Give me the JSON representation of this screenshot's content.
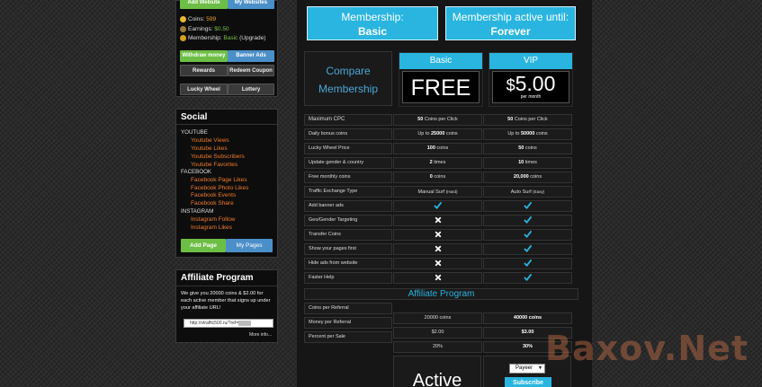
{
  "sidebar": {
    "top_buttons": {
      "add_website": "Add Website",
      "my_websites": "My Websites"
    },
    "coins_label": "Coins: ",
    "coins_value": "599",
    "earnings_label": "Earnings: ",
    "earnings_value": "$0.50",
    "membership_label": "Membership: ",
    "membership_value": "Basic",
    "membership_upgrade": "(Upgrade)",
    "buttons": {
      "withdraw": "Withdraw money",
      "banner_ads": "Banner Ads",
      "rewards": "Rewards",
      "redeem": "Redeem Coupon",
      "lucky_wheel": "Lucky Wheel",
      "lottery": "Lottery"
    }
  },
  "social": {
    "title": "Social",
    "youtube": {
      "category": "YOUTUBE",
      "items": [
        "Youtube Views",
        "Youtube Likes",
        "Youtube Subscribers",
        "Youtube Favorites"
      ]
    },
    "facebook": {
      "category": "FACEBOOK",
      "items": [
        "Facebook Page Likes",
        "Facebook Photo Likes",
        "Facebook Events",
        "Facebook Share"
      ]
    },
    "instagram": {
      "category": "INSTAGRAM",
      "items": [
        "Instagram Follow",
        "Instagram Likes"
      ]
    },
    "add_page": "Add Page",
    "my_pages": "My Pages"
  },
  "affiliate_box": {
    "title": "Affiliate Program",
    "text": "We give you 20000 coins & $2.00 for each active member that signs up under your affiliate URL!",
    "url": "http://vtraffic500.ru/?ref=",
    "more": "More info..."
  },
  "membership": {
    "label": "Membership:",
    "value": "Basic",
    "active_label": "Membership active until:",
    "active_value": "Forever"
  },
  "compare": {
    "line1": "Compare",
    "line2": "Membership",
    "basic": {
      "name": "Basic",
      "price": "FREE"
    },
    "vip": {
      "name": "VIP",
      "currency": "$",
      "price": "5.00",
      "period": "per month"
    }
  },
  "features": [
    {
      "label": "Maximum CPC",
      "basic_b": "50",
      "basic_t": " Coins per Click",
      "vip_b": "50",
      "vip_t": " Coins per Click"
    },
    {
      "label": "Daily bonus coins",
      "basic_t": "Up to ",
      "basic_b": "25000",
      "basic_t2": " coins",
      "vip_t": "Up to ",
      "vip_b": "50000",
      "vip_t2": " coins"
    },
    {
      "label": "Lucky Wheel Price",
      "basic_b": "100",
      "basic_t": " coins",
      "vip_b": "50",
      "vip_t": " coins"
    },
    {
      "label": "Update gender & country",
      "basic_b": "2",
      "basic_t": " times",
      "vip_b": "10",
      "vip_t": " times"
    },
    {
      "label": "Free monthly coins",
      "basic_b": "0",
      "basic_t": " coins",
      "vip_b": "20,000",
      "vip_t": " coins"
    },
    {
      "label": "Traffic Exchange Type",
      "basic_t": "Manual Surf ",
      "basic_s": "(Hard)",
      "vip_t": "Auto Surf ",
      "vip_s": "(Easy)"
    }
  ],
  "bool_features": [
    {
      "label": "Add banner ads",
      "basic": "check-icon",
      "vip": "check-icon"
    },
    {
      "label": "Geo/Gender Targeting",
      "basic": "cross-icon",
      "vip": "check-icon"
    },
    {
      "label": "Transfer Coins",
      "basic": "cross-icon",
      "vip": "check-icon"
    },
    {
      "label": "Show your pages first",
      "basic": "cross-icon",
      "vip": "check-icon"
    },
    {
      "label": "Hide ads from website",
      "basic": "cross-icon",
      "vip": "check-icon"
    },
    {
      "label": "Faster Help",
      "basic": "cross-icon",
      "vip": "check-icon"
    }
  ],
  "affiliate_title": "Affiliate Program",
  "affiliate_rows": [
    {
      "label": "Coins per Referral",
      "basic": "20000 coins",
      "vip": "40000 coins"
    },
    {
      "label": "Money per Referral",
      "basic": "$2.00",
      "vip": "$3.00"
    },
    {
      "label": "Percent per Sale",
      "basic": "20%",
      "vip": "30%"
    }
  ],
  "bottom": {
    "active": "Active",
    "payeer": "Payeer",
    "subscribe": "Subscribe"
  },
  "watermark": "Baxov.Net",
  "colors": {
    "accent": "#29b5e0",
    "green": "#6dbe45",
    "blue": "#4b8fc9",
    "orange": "#f07a2a"
  }
}
